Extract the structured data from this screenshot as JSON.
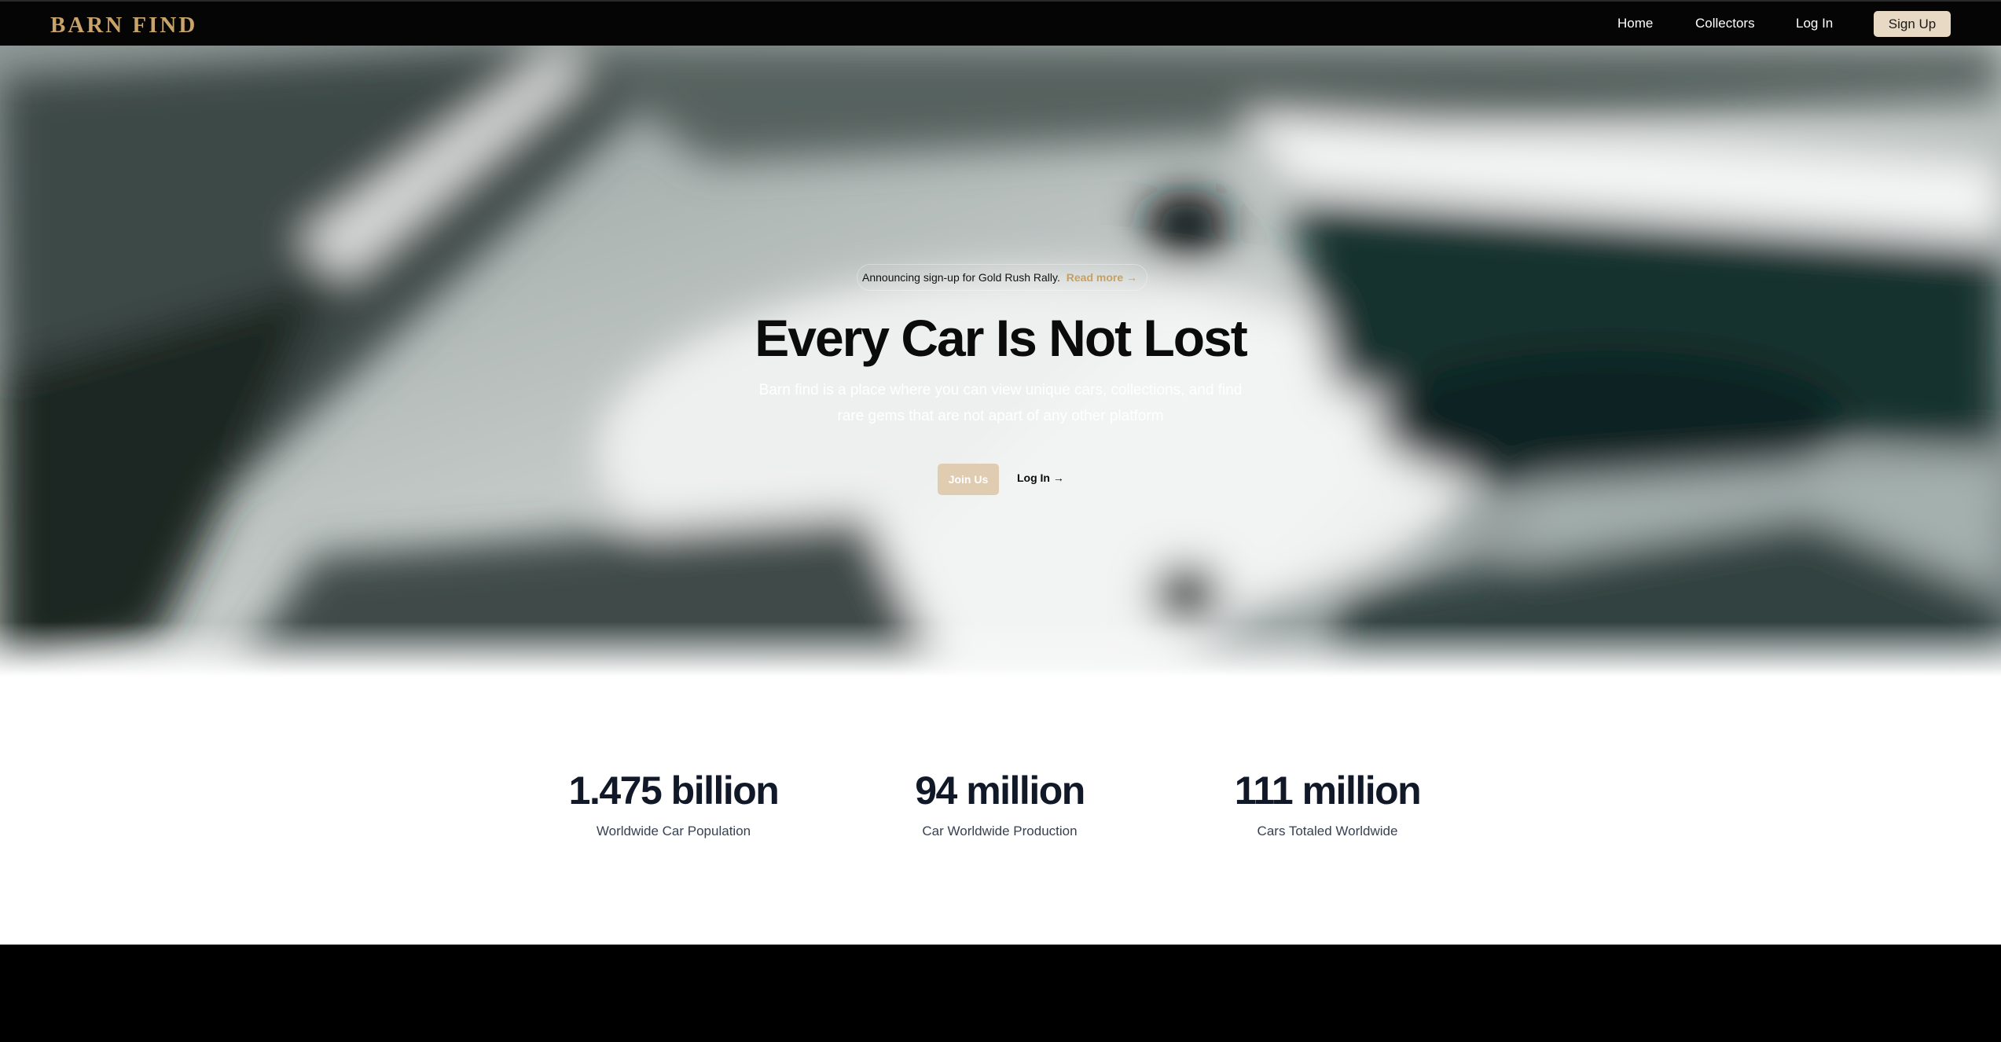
{
  "navbar": {
    "brand": "BARN FIND",
    "links": [
      {
        "label": "Home"
      },
      {
        "label": "Collectors"
      },
      {
        "label": "Log In"
      }
    ],
    "signup_label": "Sign Up"
  },
  "hero": {
    "announcement": "Announcing sign-up for Gold Rush Rally.",
    "announcement_link": "Read more →",
    "title": "Every Car Is Not Lost",
    "subtitle": "Barn find is a place where you can view unique cars, collections, and find rare gems that are not apart of any other platform",
    "primary_cta": "Join Us",
    "secondary_cta": "Log In →"
  },
  "stats": [
    {
      "value": "1.475 billion",
      "label": "Worldwide Car Population"
    },
    {
      "value": "94 million",
      "label": "Car Worldwide Production"
    },
    {
      "value": "111 million",
      "label": "Cars Totaled Worldwide"
    }
  ],
  "colors": {
    "brand_gold": "#c8a36a",
    "signup_bg": "#e7d9c4",
    "cta_bg": "#e0ccb0",
    "nav_bg": "#050505",
    "footer_bg": "#000000"
  }
}
